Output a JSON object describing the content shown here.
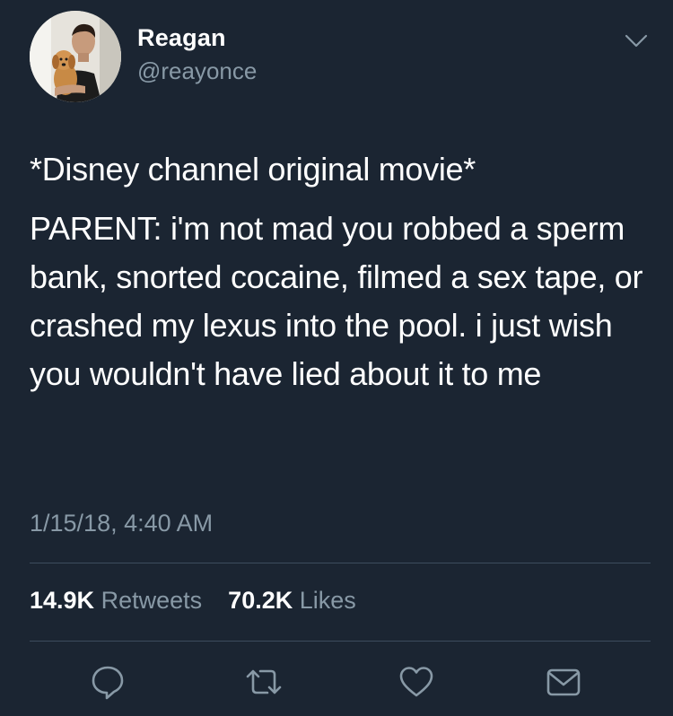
{
  "user": {
    "display_name": "Reagan",
    "handle": "@reayonce"
  },
  "tweet": {
    "lines": [
      "*Disney channel original movie*",
      "PARENT: i'm not mad you robbed a sperm bank, snorted cocaine, filmed a sex tape, or crashed my lexus into the pool. i just wish you wouldn't have lied about it to me"
    ],
    "timestamp": "1/15/18, 4:40 AM"
  },
  "stats": {
    "retweets_count": "14.9K",
    "retweets_label": "Retweets",
    "likes_count": "70.2K",
    "likes_label": "Likes"
  },
  "actions": [
    {
      "icon": "reply-icon"
    },
    {
      "icon": "retweet-icon"
    },
    {
      "icon": "like-icon"
    },
    {
      "icon": "message-icon"
    }
  ],
  "colors": {
    "background": "#1b2532",
    "text_primary": "#ffffff",
    "text_secondary": "#8899a6",
    "divider": "#3d4c5d"
  }
}
